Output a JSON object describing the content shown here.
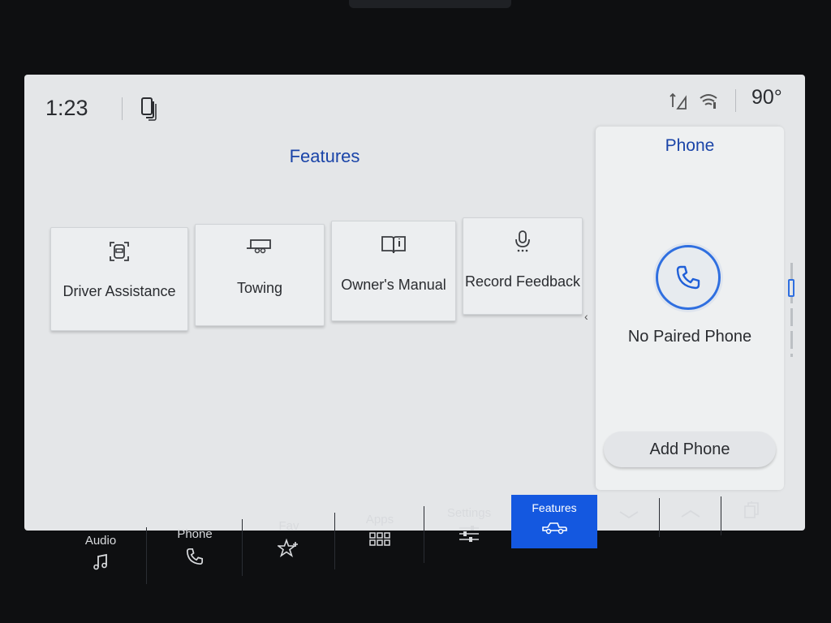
{
  "status": {
    "time": "1:23",
    "temperature": "90°",
    "icons": [
      "phone-projection-icon",
      "signal-icon",
      "wifi-icon"
    ]
  },
  "features": {
    "title": "Features",
    "tiles": [
      {
        "label": "Driver Assistance",
        "icon": "driver-assist-icon"
      },
      {
        "label": "Towing",
        "icon": "trailer-icon"
      },
      {
        "label": "Owner's Manual",
        "icon": "manual-book-icon"
      },
      {
        "label": "Record Feedback",
        "icon": "microphone-icon"
      }
    ],
    "collapse_chevron": "‹"
  },
  "phone_panel": {
    "title": "Phone",
    "status": "No Paired Phone",
    "add_button": "Add Phone"
  },
  "navbar": {
    "items": [
      {
        "label": "Audio",
        "icon": "music-note-icon"
      },
      {
        "label": "Phone",
        "icon": "phone-icon"
      },
      {
        "label": "Fav",
        "icon": "star-plus-icon"
      },
      {
        "label": "Apps",
        "icon": "apps-grid-icon"
      },
      {
        "label": "Settings",
        "icon": "sliders-icon"
      },
      {
        "label": "Features",
        "icon": "truck-icon",
        "active": true
      }
    ],
    "extra_icons": [
      "chevron-down-icon",
      "chevron-up-icon",
      "layers-icon"
    ]
  },
  "colors": {
    "accent": "#1458e0",
    "title_blue": "#1a44a8",
    "screen_bg": "#e4e6e8",
    "bezel": "#0e0f11"
  }
}
